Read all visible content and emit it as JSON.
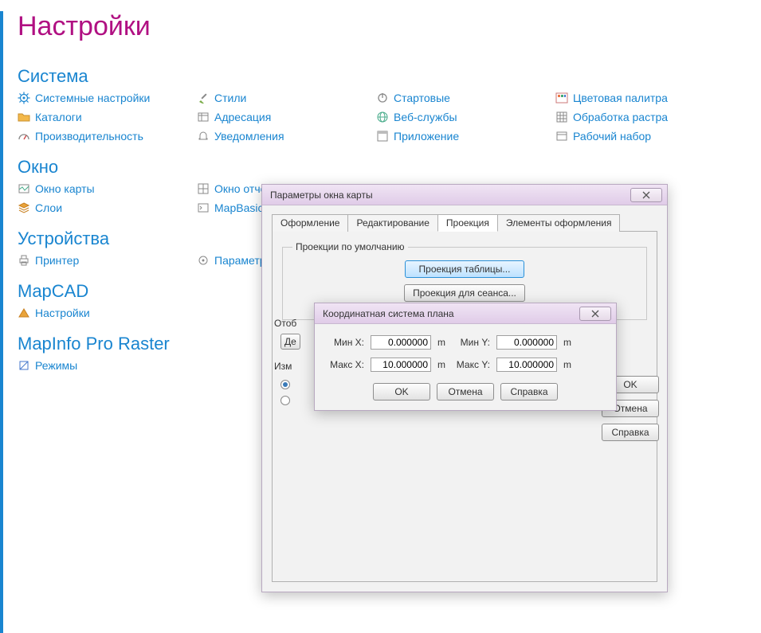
{
  "page": {
    "title": "Настройки"
  },
  "sections": {
    "system": {
      "heading": "Система",
      "items": [
        "Системные настройки",
        "Стили",
        "Стартовые",
        "Цветовая палитра",
        "Каталоги",
        "Адресация",
        "Веб-службы",
        "Обработка растра",
        "Производительность",
        "Уведомления",
        "Приложение",
        "Рабочий набор"
      ]
    },
    "window": {
      "heading": "Окно",
      "items": [
        "Окно карты",
        "Окно отчёта",
        "",
        "",
        "Слои",
        "MapBasic",
        "",
        ""
      ]
    },
    "devices": {
      "heading": "Устройства",
      "items": [
        "Принтер",
        "Параметры",
        "",
        ""
      ]
    },
    "mapcad": {
      "heading": "MapCAD",
      "items": [
        "Настройки"
      ]
    },
    "raster": {
      "heading": "MapInfo Pro Raster",
      "items": [
        "Режимы"
      ]
    }
  },
  "mapDialog": {
    "title": "Параметры окна карты",
    "tabs": [
      "Оформление",
      "Редактирование",
      "Проекция",
      "Элементы оформления"
    ],
    "activeTab": 2,
    "group": {
      "legend": "Проекции по умолчанию",
      "btn1": "Проекция таблицы...",
      "btn2": "Проекция для сеанса..."
    },
    "sideBtns": {
      "ok": "OK",
      "cancel": "Отмена",
      "help": "Справка"
    },
    "cutoff": {
      "display": "Отоб",
      "def": "Де",
      "meas": "Изм"
    }
  },
  "coordDialog": {
    "title": "Координатная система плана",
    "labels": {
      "minx": "Мин X:",
      "miny": "Мин Y:",
      "maxx": "Макс X:",
      "maxy": "Макс Y:",
      "unit": "m"
    },
    "values": {
      "minx": "0.000000",
      "miny": "0.000000",
      "maxx": "10.000000",
      "maxy": "10.000000"
    },
    "btns": {
      "ok": "OK",
      "cancel": "Отмена",
      "help": "Справка"
    }
  }
}
